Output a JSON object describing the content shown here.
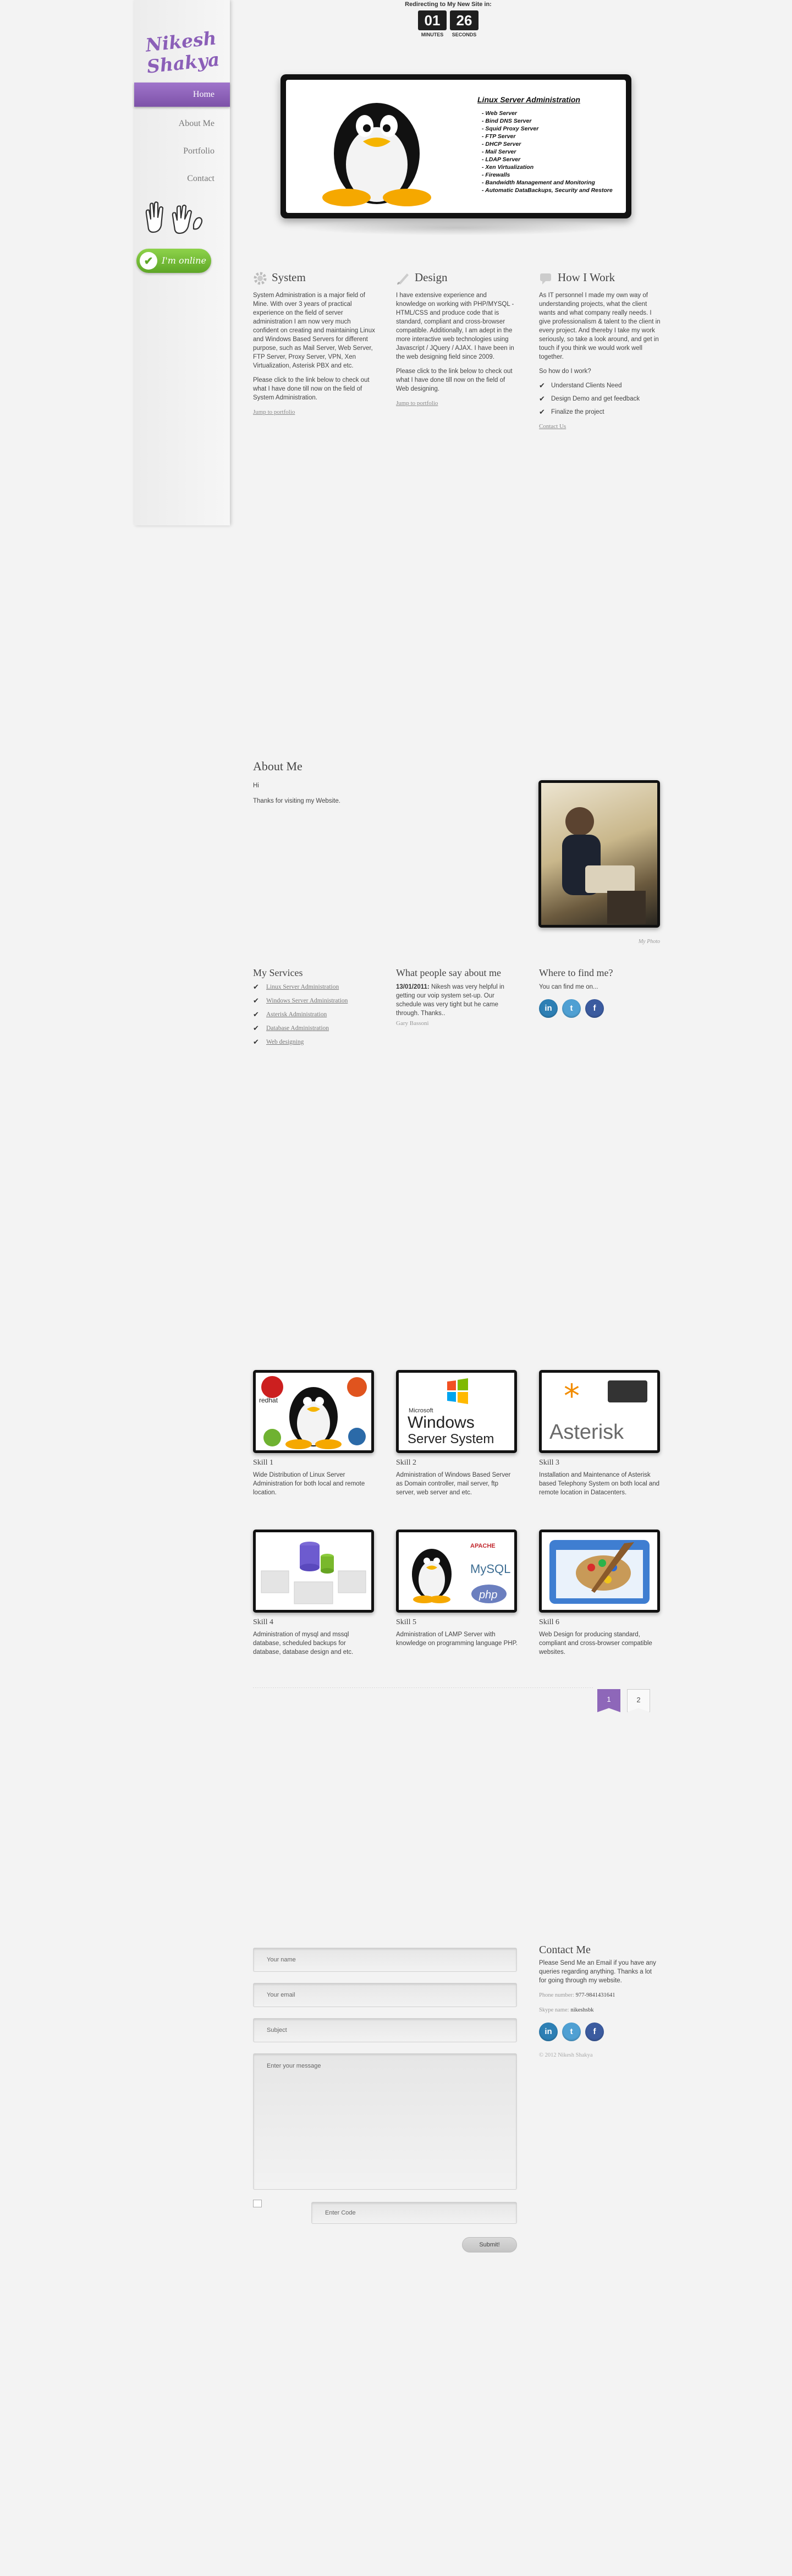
{
  "sidebar": {
    "logo_text": "Nikesh Shakya",
    "nav": [
      {
        "label": "Home",
        "active": true
      },
      {
        "label": "About Me",
        "active": false
      },
      {
        "label": "Portfolio",
        "active": false
      },
      {
        "label": "Contact",
        "active": false
      }
    ],
    "online_label": "I'm online"
  },
  "countdown": {
    "title": "Redirecting to My New Site in:",
    "minutes": "01",
    "seconds": "26",
    "minutes_label": "MINUTES",
    "seconds_label": "SECONDS"
  },
  "banner": {
    "title": "Linux Server Administration",
    "items": [
      "Web Server",
      "Bind DNS Server",
      "Squid Proxy Server",
      "FTP Server",
      "DHCP Server",
      "Mail Server",
      "LDAP Server",
      "Xen Virtualization",
      "Firewalls",
      "Bandwidth Management and Monitoring",
      "Automatic DataBackups, Security and Restore"
    ]
  },
  "columns": [
    {
      "title": "System",
      "icon": "gear-icon",
      "paragraphs": [
        "System Administration is a major field of Mine. With over 3 years of practical experience on the field of server administration I am now very much confident on creating and maintaining Linux and Windows Based Servers for different purpose, such as Mail Server, Web Server, FTP Server, Proxy Server, VPN, Xen Virtualization, Asterisk PBX and etc.",
        "Please click to the link below to check out what I have done till now on the field of System Administration."
      ],
      "link": "Jump to portfolio"
    },
    {
      "title": "Design",
      "icon": "brush-icon",
      "paragraphs": [
        "I have extensive experience and knowledge on working with PHP/MYSQL - HTML/CSS and produce code that is standard, compliant and cross-browser compatible. Additionally, I am adept in the more interactive web technologies using Javascript / JQuery / AJAX. I have been in the web designing field since 2009.",
        "Please click to the link below to check out what I have done till now on the field of Web designing."
      ],
      "link": "Jump to portfolio"
    },
    {
      "title": "How I Work",
      "icon": "chat-icon",
      "paragraphs": [
        "As IT personnel I made my own way of understanding projects, what the client wants and what company really needs. I give professionalism & talent to the client in every project. And thereby I take my work seriously, so take a look around, and get in touch if you think we would work well together.",
        "So how do I work?"
      ],
      "checks": [
        "Understand Clients Need",
        "Design Demo and get feedback",
        "Finalize the project"
      ],
      "link": "Contact Us"
    }
  ],
  "about": {
    "title": "About Me",
    "lines": [
      "Hi",
      "Thanks for visiting my Website."
    ],
    "photo_caption": "My Photo"
  },
  "services": {
    "title": "My Services",
    "items": [
      "Linux Server Administration",
      "Windows Server Administration",
      "Asterisk Administration",
      "Database Administration",
      "Web designing"
    ]
  },
  "testimonial": {
    "title": "What people say about me",
    "date": "13/01/2011:",
    "text": " Nikesh was very helpful in getting our voip system set-up. Our schedule was very tight but he came through. Thanks..",
    "author": "Gary Bassoni"
  },
  "where": {
    "title": "Where to find me?",
    "text": "You can find me on..."
  },
  "skills": [
    {
      "title": "Skill 1",
      "desc": "Wide Distribution of Linux Server Administration for both local and remote location."
    },
    {
      "title": "Skill 2",
      "desc": "Administration of Windows Based Server as Domain controller, mail server, ftp server, web server and etc."
    },
    {
      "title": "Skill 3",
      "desc": "Installation and Maintenance of Asterisk based Telephony System on both local and remote location in Datacenters."
    },
    {
      "title": "Skill 4",
      "desc": "Administration of mysql and mssql database, scheduled backups for database, database design and etc."
    },
    {
      "title": "Skill 5",
      "desc": "Administration of LAMP Server with knowledge on programming language PHP."
    },
    {
      "title": "Skill 6",
      "desc": "Web Design for producing standard, compliant and cross-browser compatible websites."
    }
  ],
  "skill_logos": {
    "redhat": "redhat",
    "windows_small": "Microsoft",
    "windows_big": "Windows",
    "windows_sub": "Server System",
    "asterisk": "Asterisk",
    "apache": "APACHE",
    "mysql": "MySQL",
    "php": "php"
  },
  "pagination": {
    "pages": [
      "1",
      "2"
    ]
  },
  "contact_form": {
    "name_placeholder": "Your name",
    "email_placeholder": "Your email",
    "subject_placeholder": "Subject",
    "message_placeholder": "Enter your message",
    "captcha_placeholder": "Enter Code",
    "submit_label": "Submit!"
  },
  "contact_info": {
    "title": "Contact Me",
    "text": "Please Send Me an Email if you have any queries regarding anything. Thanks a lot for going through my website.",
    "phone_label": "Phone number:",
    "phone": "977-9841431641",
    "skype_label": "Skype name:",
    "skype": "nikeshsbk",
    "copyright": "© 2012 Nikesh Shakya"
  },
  "colors": {
    "accent": "#8e67b9",
    "online": "#5ea627",
    "linkedin": "#2d7fb4",
    "twitter": "#4fa0d3",
    "facebook": "#3b5b9f"
  }
}
